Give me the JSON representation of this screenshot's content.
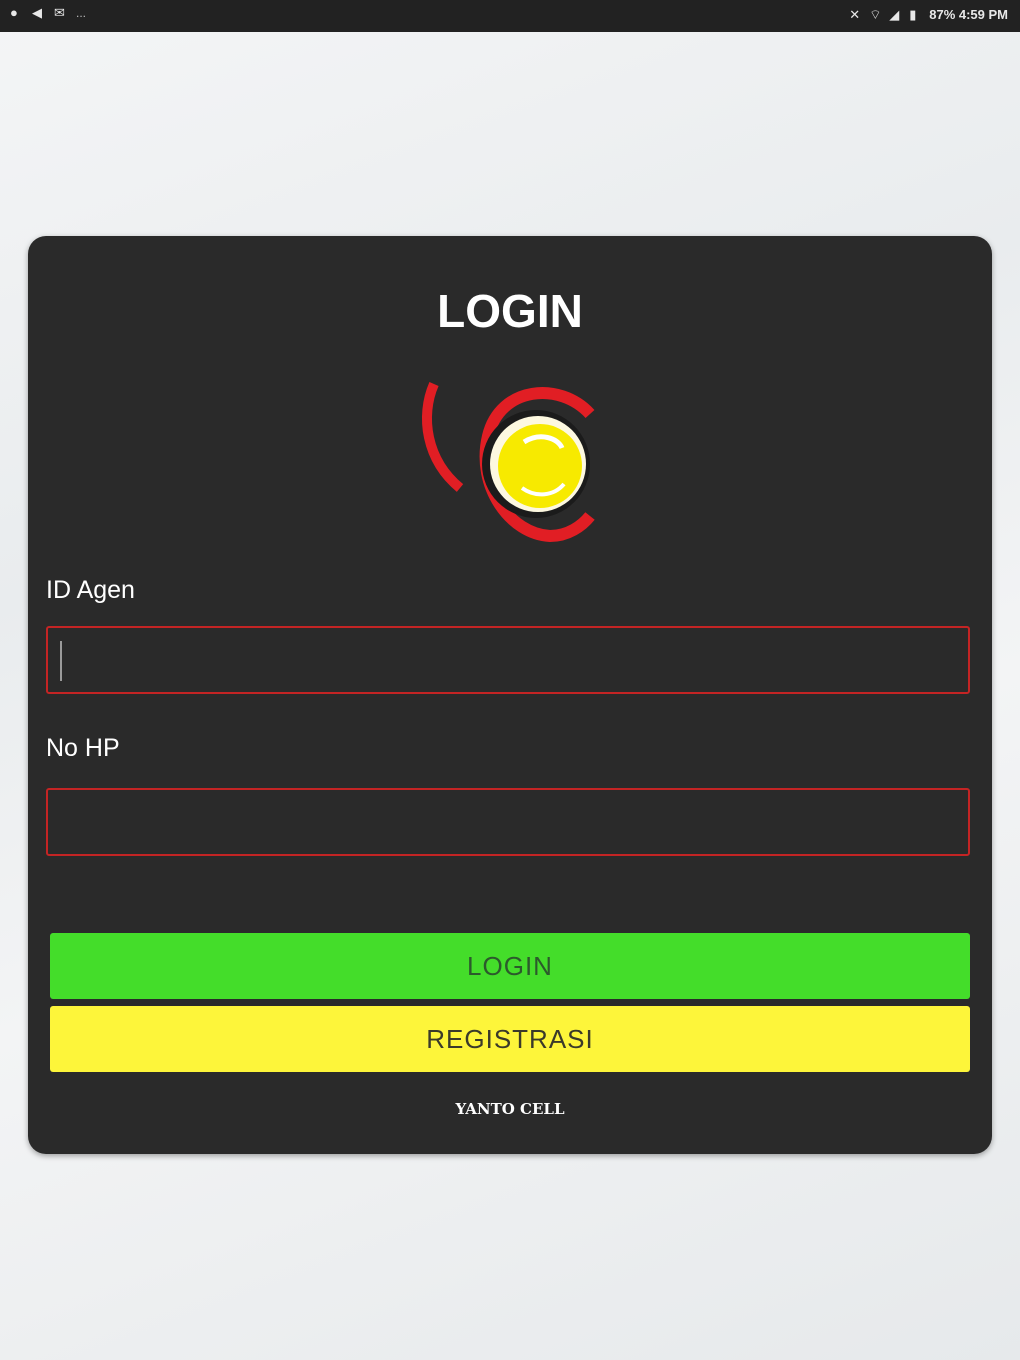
{
  "statusbar": {
    "left_icons": [
      "chat-icon",
      "telegram-icon",
      "mail-icon"
    ],
    "more_dots": "...",
    "right_icons": [
      "mute-icon",
      "wifi-icon",
      "signal-icon",
      "battery-icon"
    ],
    "right_text": "87% 4:59 PM"
  },
  "login": {
    "title": "LOGIN",
    "logo_colors": {
      "ring": "#e11e24",
      "ball": "#f7ea00",
      "outline": "#1b1b1b"
    },
    "id_label": "ID Agen",
    "id_value": "",
    "phone_label": "No HP",
    "phone_value": "",
    "login_button": "LOGIN",
    "register_button": "REGISTRASI",
    "footer": "YANTO CELL"
  },
  "colors": {
    "card_bg": "#2a2a2a",
    "input_border": "#c42424",
    "login_btn": "#44dd2a",
    "register_btn": "#fdf53a"
  }
}
